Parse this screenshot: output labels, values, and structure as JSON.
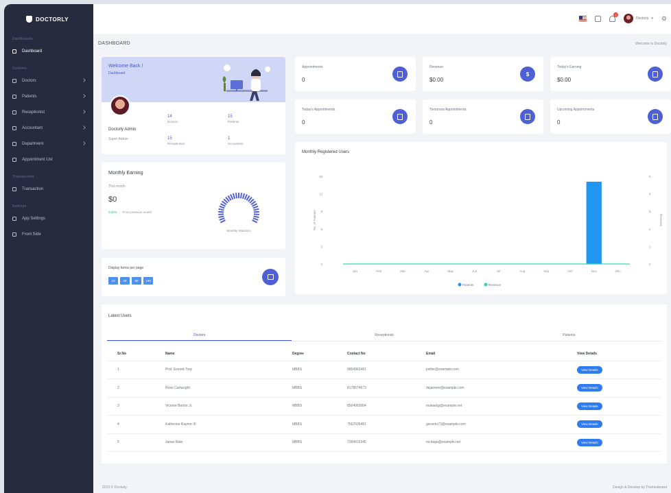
{
  "app": {
    "logo_text": "DOCTORLY"
  },
  "sidebar": {
    "sections": [
      {
        "title": "Dashboards",
        "items": [
          {
            "label": "Dashboard",
            "active": true,
            "chevron": false
          }
        ]
      },
      {
        "title": "Systems",
        "items": [
          {
            "label": "Doctors",
            "active": false,
            "chevron": true
          },
          {
            "label": "Patients",
            "active": false,
            "chevron": true
          },
          {
            "label": "Receptionist",
            "active": false,
            "chevron": true
          },
          {
            "label": "Accountant",
            "active": false,
            "chevron": true
          },
          {
            "label": "Department",
            "active": false,
            "chevron": true
          },
          {
            "label": "Appointment List",
            "active": false,
            "chevron": false
          }
        ]
      },
      {
        "title": "Transactions",
        "items": [
          {
            "label": "Transaction",
            "active": false,
            "chevron": false
          }
        ]
      },
      {
        "title": "Settings",
        "items": [
          {
            "label": "App Settings",
            "active": false,
            "chevron": false
          },
          {
            "label": "Front Side",
            "active": false,
            "chevron": false
          }
        ]
      }
    ]
  },
  "topbar": {
    "user_name": "Doctorly",
    "notification_count": "2"
  },
  "page": {
    "title": "DASHBOARD",
    "breadcrumb": "Welcome to Doctorly"
  },
  "welcome": {
    "title": "Welcome Back !",
    "subtitle": "Dashboard",
    "admin_name": "Doctorly Admin",
    "admin_role": "Super Admin",
    "stats": [
      {
        "value": "14",
        "label": "Doctors"
      },
      {
        "value": "15",
        "label": "Patients"
      },
      {
        "value": "15",
        "label": "Receptionist"
      },
      {
        "value": "1",
        "label": "Accountant"
      }
    ]
  },
  "earning": {
    "title": "Monthly Earning",
    "period_label": "This month",
    "amount": "$0",
    "change": "0.00% ↑",
    "change_text": "From previous month",
    "gauge_label": "Monthly Statistics",
    "gauge_value": 0
  },
  "display_items": {
    "label": "Display Items per page",
    "options": [
      "10",
      "25",
      "50",
      "100"
    ]
  },
  "stat_cards": [
    {
      "label": "Appointments",
      "value": "0",
      "icon": "clipboard-icon"
    },
    {
      "label": "Revenue",
      "value": "$0.00",
      "icon": "dollar-icon"
    },
    {
      "label": "Today's Earning",
      "value": "$0.00",
      "icon": "coins-icon"
    },
    {
      "label": "Today's Appointments",
      "value": "0",
      "icon": "calendar-icon"
    },
    {
      "label": "Tomorrow Appointments",
      "value": "0",
      "icon": "calendar-check-icon"
    },
    {
      "label": "Upcoming Appointments",
      "value": "0",
      "icon": "calendar-clock-icon"
    }
  ],
  "chart_data": {
    "type": "bar",
    "title": "Monthly Registered Users",
    "categories": [
      "Jan",
      "Feb",
      "Mar",
      "Apr",
      "May",
      "Jun",
      "Jul",
      "Aug",
      "Sep",
      "Oct",
      "Nov",
      "Dec"
    ],
    "series": [
      {
        "name": "Patients",
        "type": "bar",
        "values": [
          0,
          0,
          0,
          0,
          0,
          0,
          0,
          0,
          0,
          0,
          15,
          0
        ],
        "color": "#2196f3"
      },
      {
        "name": "Revenue",
        "type": "line",
        "values": [
          0,
          0,
          0,
          0,
          0,
          0,
          0,
          0,
          0,
          0,
          0,
          0
        ],
        "color": "#3ad3b0"
      }
    ],
    "ylabel": "No. of Patients",
    "y2label": "Revenue",
    "y_ticks": [
      "0",
      "3",
      "6",
      "9",
      "12",
      "16"
    ],
    "y2_ticks": [
      "0",
      "1",
      "2",
      "3",
      "4",
      "5"
    ],
    "ylim": [
      0,
      16
    ],
    "legend": "bottom"
  },
  "latest_users": {
    "title": "Latest Users",
    "tabs": [
      {
        "label": "Doctors",
        "active": true
      },
      {
        "label": "Receptionist",
        "active": false
      },
      {
        "label": "Patients",
        "active": false
      }
    ],
    "columns": [
      "Sr.No",
      "Name",
      "Degree",
      "Contact No",
      "Email",
      "View Details"
    ],
    "rows": [
      [
        "1",
        "Prof. Everett Torp",
        "MBBS",
        "9854962481",
        "jmiller@example.com",
        "View Details"
      ],
      [
        "2",
        "Rose Cartwright",
        "MBBS",
        "8178574673",
        "dejamore@example.com",
        "View Details"
      ],
      [
        "3",
        "Vicente Barton Jr.",
        "MBBS",
        "8564083064",
        "makaelgi@example.net",
        "View Details"
      ],
      [
        "4",
        "Katherine Raynor III",
        "MBBS",
        "7562935481",
        "gerardo73@example.com",
        "View Details"
      ],
      [
        "5",
        "Janae Bate",
        "MBBS",
        "7284916345",
        "mcdaga@example.net",
        "View Details"
      ]
    ]
  },
  "footer": {
    "left": "2023 © Doctorly.",
    "right": "Design & Develop by Themesbrand"
  }
}
